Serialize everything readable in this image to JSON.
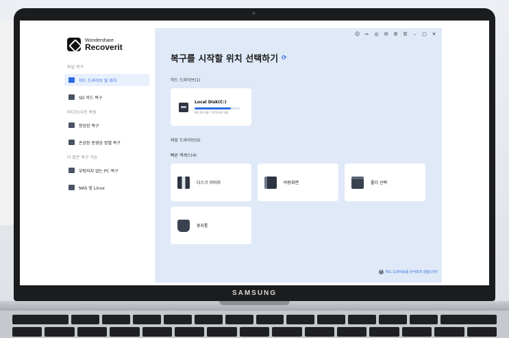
{
  "app": {
    "logo_sub": "Wondershare",
    "logo_main": "Recoverit",
    "brand_badge": "SAMSUNG"
  },
  "sidebar": {
    "sections": [
      {
        "title": "파일 복구"
      },
      {
        "title": "비디오/사진 복원"
      },
      {
        "title": "더 많은 복구 기능"
      }
    ],
    "items": [
      {
        "label": "하드 드라이브 및 위치",
        "active": true
      },
      {
        "label": "SD 카드 복구"
      },
      {
        "label": "향상된 복구"
      },
      {
        "label": "손상된 동영상 정렬 복구"
      },
      {
        "label": "부팅되지 않는 PC 복구"
      },
      {
        "label": "NAS 및 Linux"
      }
    ]
  },
  "main": {
    "title": "복구를 시작할 위치 선택하기",
    "hard_drives_label": "하드 드라이브(1)",
    "drive": {
      "name": "Local Disk(C:)",
      "size": "96.29 GB / 476.83 GB",
      "usage_fraction": 0.8
    },
    "external_label": "외장 드라이브(0)",
    "quick_access_label": "빠른 액세스(4)",
    "quick": [
      {
        "label": "디스크 이미지",
        "icon": "disk-image-icon"
      },
      {
        "label": "바탕화면",
        "icon": "desktop-icon"
      },
      {
        "label": "폴더 선택",
        "icon": "folder-icon"
      },
      {
        "label": "휴지통",
        "icon": "trash-icon"
      }
    ],
    "help_link": "하드 드라이브를 인식되지 않습니까?"
  },
  "colors": {
    "accent": "#2a6be0",
    "main_bg": "#dfe9f8",
    "active_bg": "#e9f0fd"
  }
}
